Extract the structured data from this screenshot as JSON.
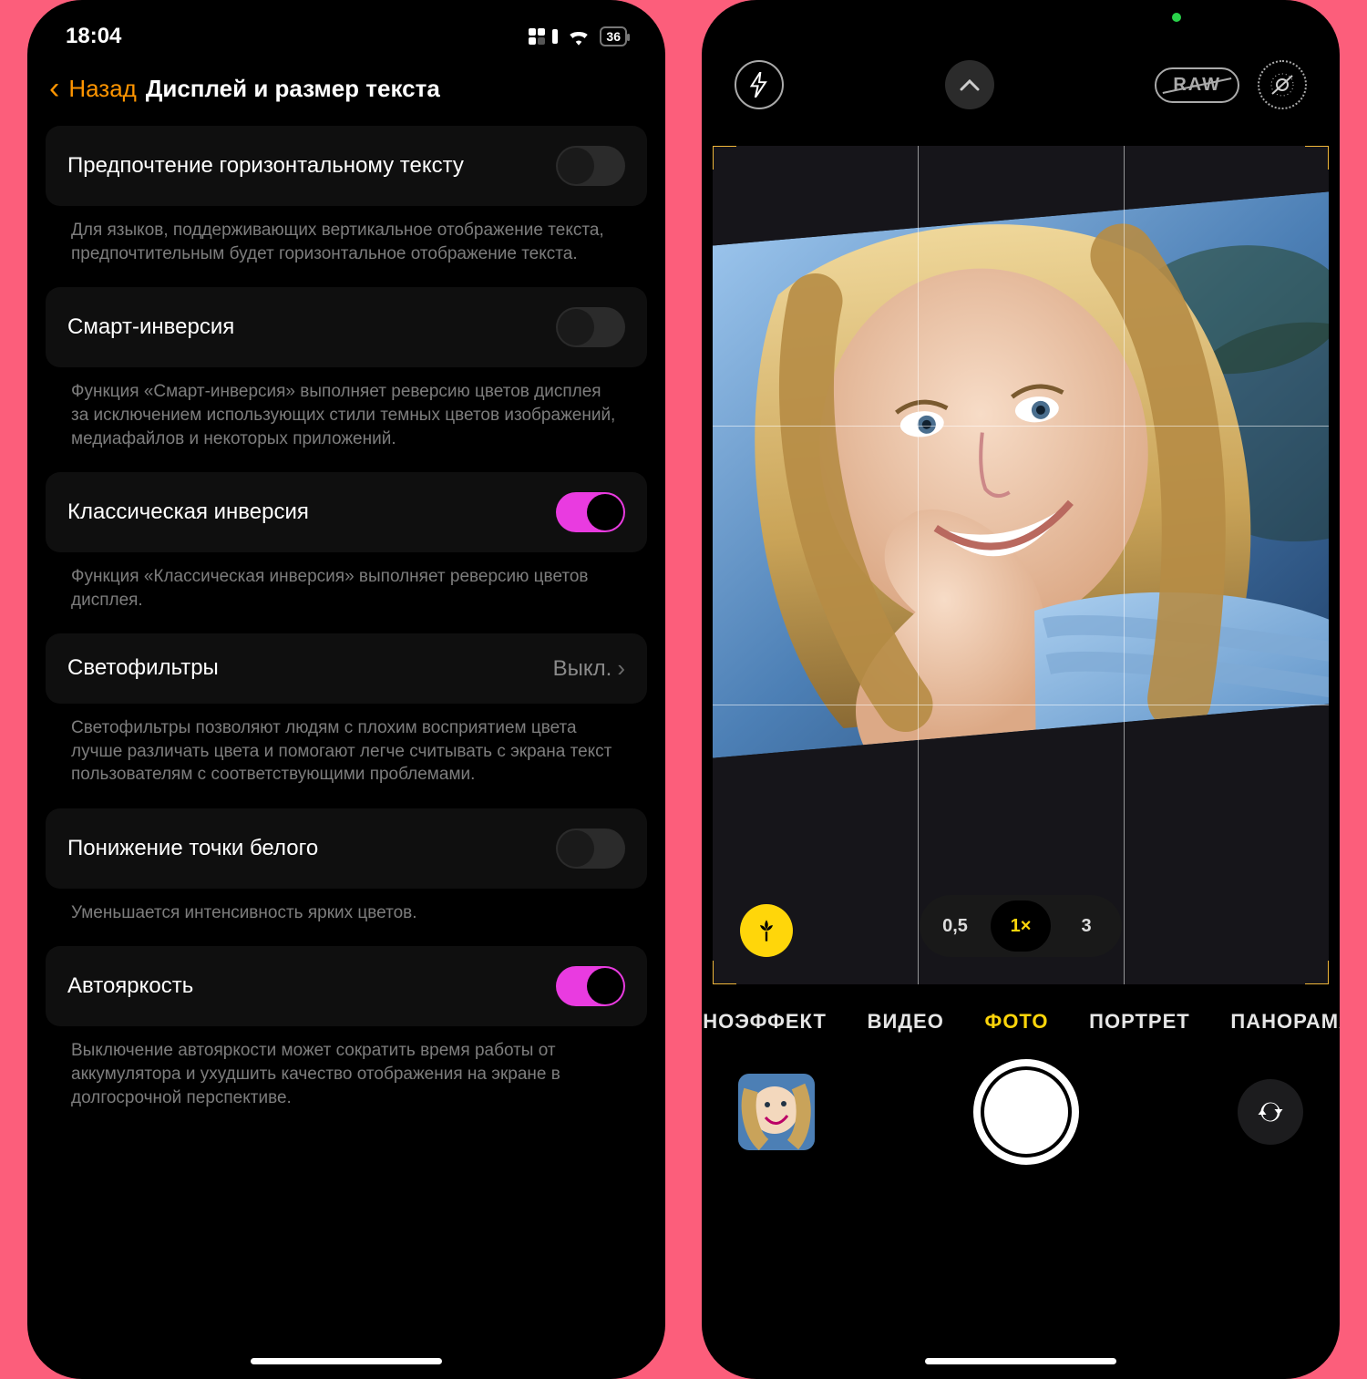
{
  "settings": {
    "status": {
      "time": "18:04",
      "battery": "36"
    },
    "nav": {
      "back": "Назад",
      "title": "Дисплей и размер текста"
    },
    "items": [
      {
        "label": "Предпочтение горизонтальному тексту",
        "type": "toggle",
        "on": false,
        "footer": "Для языков, поддерживающих вертикальное отображение текста, предпочтительным будет горизонтальное отображение текста."
      },
      {
        "label": "Смарт-инверсия",
        "type": "toggle",
        "on": false,
        "footer": "Функция «Смарт-инверсия» выполняет реверсию цветов дисплея за исключением использующих стили темных цветов изображений, медиафайлов и некоторых приложений."
      },
      {
        "label": "Классическая инверсия",
        "type": "toggle",
        "on": true,
        "footer": "Функция «Классическая инверсия» выполняет реверсию цветов дисплея."
      },
      {
        "label": "Светофильтры",
        "type": "link",
        "value": "Выкл.",
        "footer": "Светофильтры позволяют людям с плохим восприятием цвета лучше различать цвета и помогают легче считывать с экрана текст пользователям с соответствующими проблемами."
      },
      {
        "label": "Понижение точки белого",
        "type": "toggle",
        "on": false,
        "footer": "Уменьшается интенсивность ярких цветов."
      },
      {
        "label": "Автояркость",
        "type": "toggle",
        "on": true,
        "footer": "Выключение автояркости может сократить время работы от аккумулятора и ухудшить качество отображения на экране в долгосрочной перспективе."
      }
    ]
  },
  "camera": {
    "raw_label": "RAW",
    "zoom": {
      "options": [
        "0,5",
        "1×",
        "3"
      ],
      "active": 1
    },
    "modes": {
      "items": [
        "КИНОЭФФЕКТ",
        "ВИДЕО",
        "ФОТО",
        "ПОРТРЕТ",
        "ПАНОРАМА"
      ],
      "active": 2
    }
  },
  "colors": {
    "accent_orange": "#ff9500",
    "accent_pink": "#e93be0",
    "accent_yellow": "#ffd60a"
  }
}
